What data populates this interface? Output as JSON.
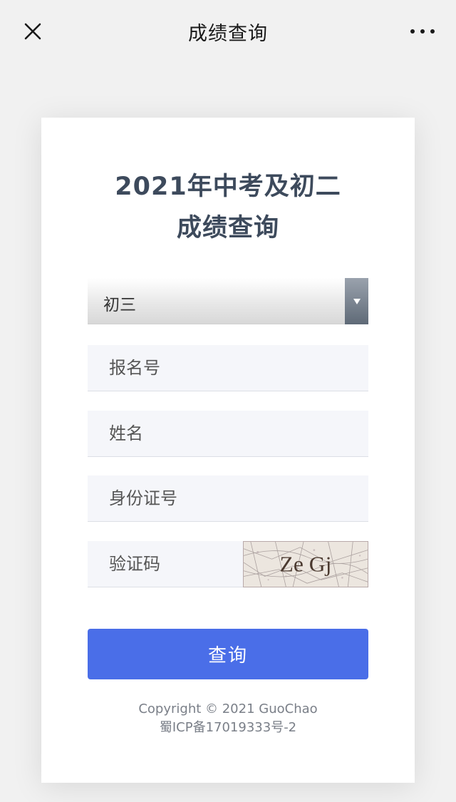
{
  "topbar": {
    "title": "成绩查询",
    "close_icon": "close-icon",
    "more_icon": "more-icon"
  },
  "card": {
    "heading_line1": "2021年中考及初二",
    "heading_line2": "成绩查询",
    "grade_select": {
      "selected": "初三",
      "icon": "dropdown-arrow-icon"
    },
    "registration_number": {
      "placeholder": "报名号",
      "value": ""
    },
    "name": {
      "placeholder": "姓名",
      "value": ""
    },
    "id_number": {
      "placeholder": "身份证号",
      "value": ""
    },
    "captcha": {
      "placeholder": "验证码",
      "value": "",
      "image_text": "Ze Gj"
    },
    "submit_label": "查询",
    "footer_line1": "Copyright © 2021 GuoChao",
    "footer_line2": "蜀ICP备17019333号-2"
  },
  "colors": {
    "accent": "#4a6ee8",
    "heading": "#3d4a5c",
    "field_bg": "#f5f6fa",
    "page_bg": "#f1f1f1"
  }
}
